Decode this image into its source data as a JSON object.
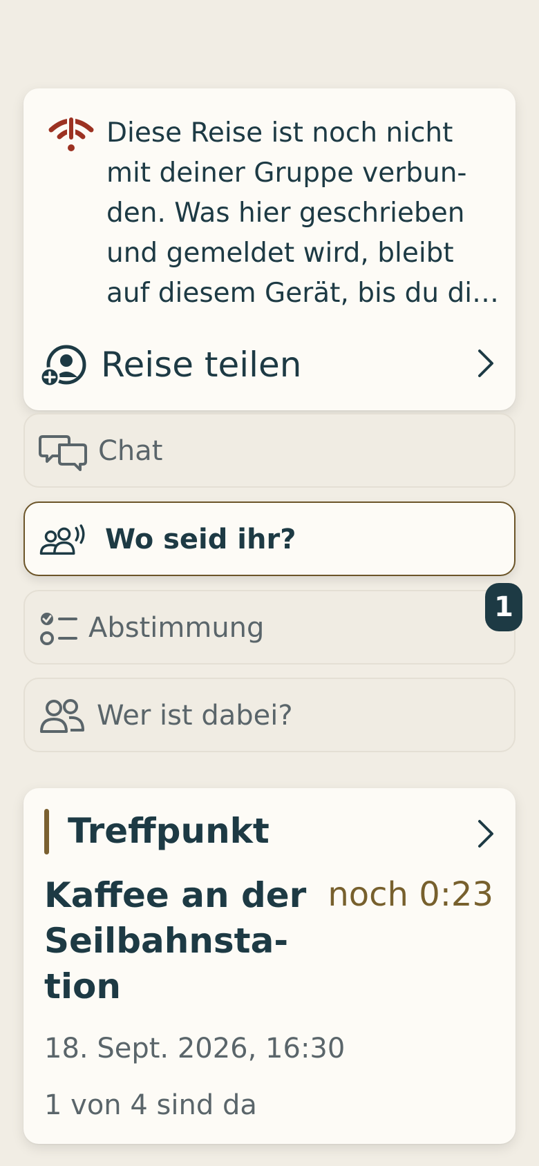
{
  "banner": {
    "icon": "wifi-off-icon",
    "message": "Diese Reise ist noch nicht mit deiner Gruppe verbun-den. Was hier geschrieben und gemeldet wird, bleibt auf diesem Gerät, bis du di…",
    "share_label": "Reise teilen",
    "share_icon": "add-person-icon",
    "alert_color": "#9c3222"
  },
  "nav": {
    "chat": {
      "label": "Chat",
      "icon": "chat-bubbles-icon"
    },
    "where": {
      "label": "Wo seid ihr?",
      "icon": "group-broadcast-icon",
      "active": true
    },
    "vote": {
      "label": "Abstimmung",
      "icon": "checklist-icon",
      "badge": "1"
    },
    "members": {
      "label": "Wer ist dabei?",
      "icon": "people-icon"
    }
  },
  "meeting": {
    "heading": "Treffpunkt",
    "place": "Kaffee an der Seilbahnsta-tion",
    "countdown": "noch 0:23",
    "datetime": "18. Sept. 2026, 16:30",
    "attendance": "1 von 4 sind da",
    "accent_color": "#77602d"
  },
  "colors": {
    "background": "#f1ede4",
    "card": "#fdfbf6",
    "text": "#1d3a44"
  }
}
